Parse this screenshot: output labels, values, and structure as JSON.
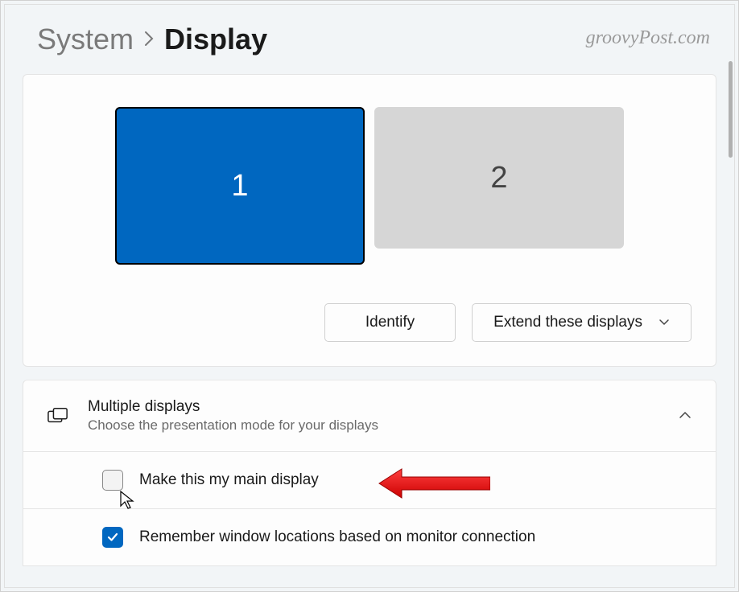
{
  "breadcrumb": {
    "parent": "System",
    "current": "Display"
  },
  "watermark": "groovyPost.com",
  "displays": {
    "monitor1": "1",
    "monitor2": "2"
  },
  "actions": {
    "identify": "Identify",
    "extend": "Extend these displays"
  },
  "multiple_displays": {
    "title": "Multiple displays",
    "subtitle": "Choose the presentation mode for your displays"
  },
  "options": {
    "main_display": "Make this my main display",
    "remember_windows": "Remember window locations based on monitor connection"
  }
}
